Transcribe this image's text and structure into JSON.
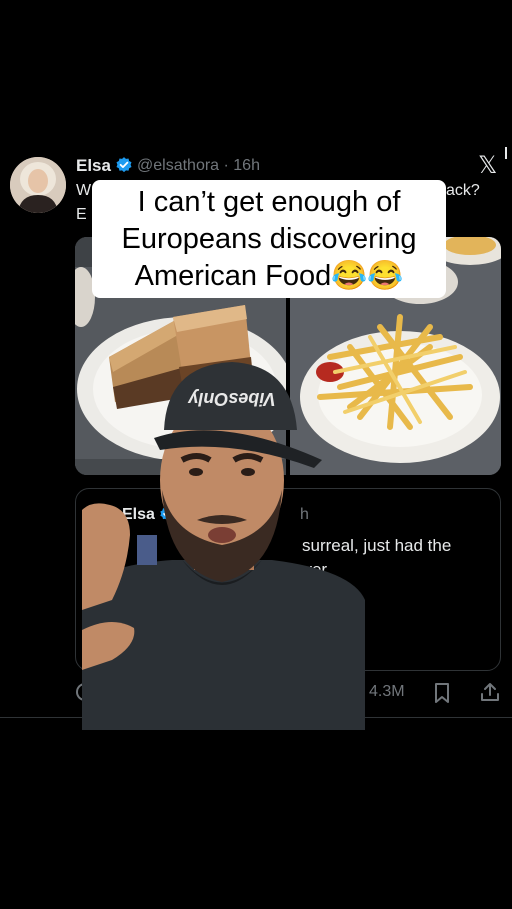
{
  "tweet": {
    "author_name": "Elsa",
    "handle_time": "@elsathora · 16h",
    "text_line1_start": "W",
    "text_line1_end": "ack?",
    "text_line2_start": "E"
  },
  "caption": {
    "line1": "I can’t get enough of",
    "line2": "Europeans discovering",
    "line3": "American Food😂😂"
  },
  "quoted": {
    "author_name": "Elsa",
    "time_fragment": "h",
    "text_line1": "surreal, just had the",
    "text_line2": "ever"
  },
  "actions": {
    "views": "4.3M"
  },
  "cap_logo": "VibesOnly",
  "colors": {
    "background": "#000000",
    "text": "#e7e9ea",
    "muted": "#71767b",
    "verified": "#1d9bf0",
    "border": "#2f3336"
  }
}
